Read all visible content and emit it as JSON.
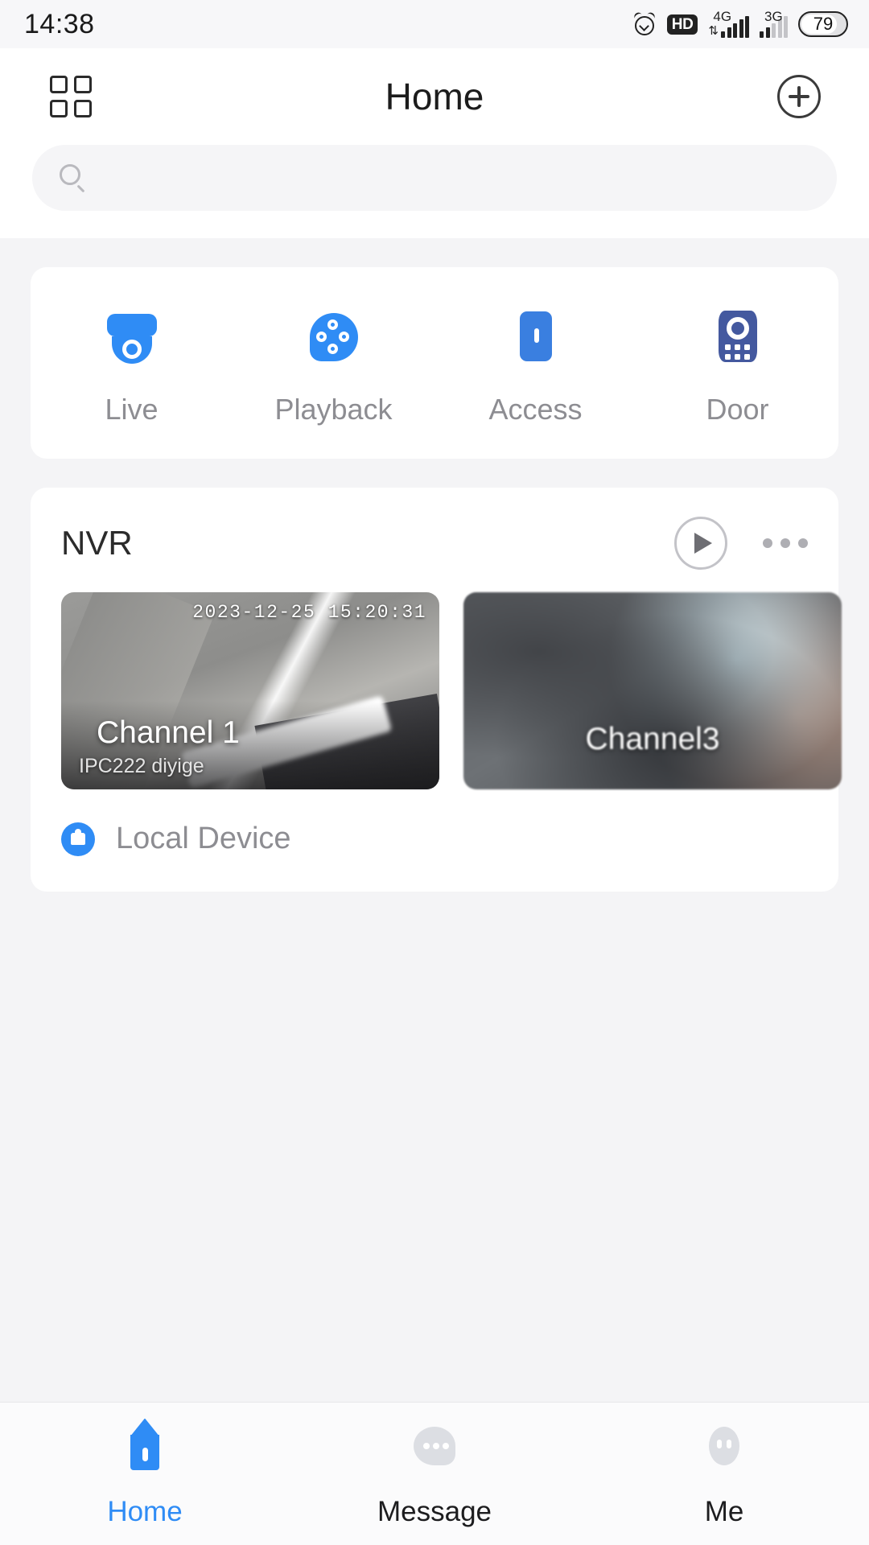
{
  "status_bar": {
    "time": "14:38",
    "alarm_icon": "alarm-clock-icon",
    "hd_badge": "HD",
    "sim1_network": "4G",
    "sim2_network": "3G",
    "battery_percent": "79"
  },
  "header": {
    "grid_icon": "grid-menu-icon",
    "title": "Home",
    "add_icon": "plus-circle-icon"
  },
  "search": {
    "icon": "search-icon",
    "placeholder": "",
    "value": ""
  },
  "quick_actions": [
    {
      "label": "Live",
      "icon": "dome-camera-icon"
    },
    {
      "label": "Playback",
      "icon": "film-reel-icon"
    },
    {
      "label": "Access",
      "icon": "door-access-icon"
    },
    {
      "label": "Door",
      "icon": "intercom-panel-icon"
    }
  ],
  "device_card": {
    "title": "NVR",
    "play_icon": "play-circle-icon",
    "more_icon": "more-horizontal-icon",
    "channels": [
      {
        "name": "Channel 1",
        "subtitle": "IPC222 diyige",
        "timestamp": "2023-12-25 15:20:31"
      },
      {
        "name": "Channel3",
        "subtitle": "",
        "timestamp": ""
      }
    ],
    "local_device": {
      "icon": "local-storage-icon",
      "label": "Local Device"
    }
  },
  "tabbar": [
    {
      "label": "Home",
      "icon": "home-icon",
      "active": true
    },
    {
      "label": "Message",
      "icon": "message-icon",
      "active": false
    },
    {
      "label": "Me",
      "icon": "person-icon",
      "active": false
    }
  ],
  "colors": {
    "accent": "#2f8cf5",
    "page_bg": "#f4f4f6",
    "card_bg": "#ffffff",
    "muted_text": "#8d8d92"
  }
}
